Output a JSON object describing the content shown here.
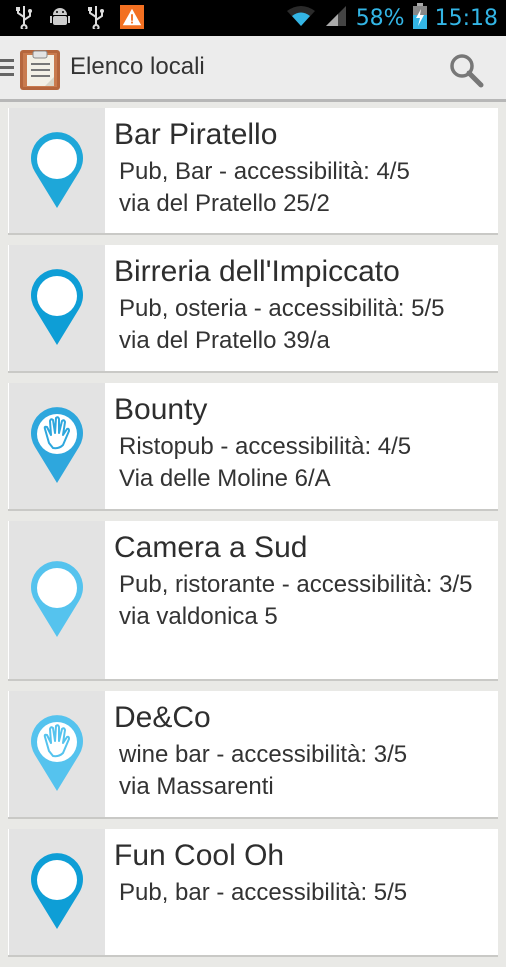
{
  "status_bar": {
    "battery_percent": "58%",
    "time": "15:18",
    "icons": [
      "usb-icon",
      "android-debug-icon",
      "usb-icon",
      "warning-icon",
      "wifi-icon",
      "signal-icon",
      "battery-charging-icon"
    ]
  },
  "action_bar": {
    "title": "Elenco locali",
    "search_icon": "search-icon"
  },
  "places": [
    {
      "name": "Bar Piratello",
      "category": "Pub, Bar - accessibilità: 4/5",
      "address": "via del Pratello 25/2",
      "marker": "pin-plain",
      "color": "#1ea7d9"
    },
    {
      "name": "Birreria dell'Impiccato",
      "category": "Pub, osteria - accessibilità: 5/5",
      "address": "via del Pratello 39/a",
      "marker": "pin-plain",
      "color": "#0e9ed6"
    },
    {
      "name": "Bounty",
      "category": "Ristopub  - accessibilità: 4/5",
      "address": "Via delle Moline 6/A",
      "marker": "pin-hand",
      "color": "#2ea7dd"
    },
    {
      "name": "Camera a Sud",
      "category": "Pub, ristorante - accessibilità: 3/5",
      "address": "via valdonica 5",
      "marker": "pin-plain",
      "color": "#55c3ee"
    },
    {
      "name": "De&Co",
      "category": "wine bar - accessibilità: 3/5",
      "address": "via  Massarenti",
      "marker": "pin-hand",
      "color": "#55c3ee"
    },
    {
      "name": "Fun Cool Oh",
      "category": "Pub, bar - accessibilità: 5/5",
      "address": "",
      "marker": "pin-plain",
      "color": "#0e9ed6"
    }
  ]
}
